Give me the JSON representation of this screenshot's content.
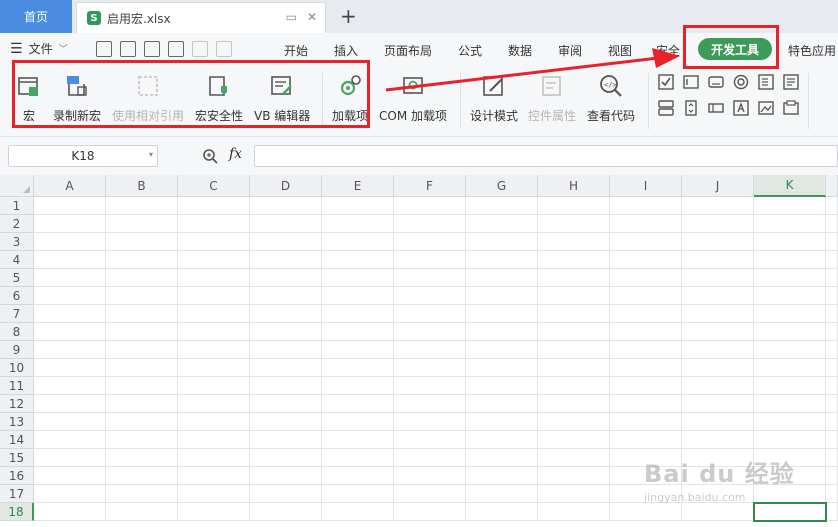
{
  "tabs": {
    "home": "首页",
    "file": "启用宏.xlsx",
    "file_icon": "S"
  },
  "menu": {
    "file_label": "文件",
    "items": [
      "开始",
      "插入",
      "页面布局",
      "公式",
      "数据",
      "审阅",
      "视图",
      "安全"
    ],
    "active": "开发工具",
    "after": "特色应用"
  },
  "ribbon": {
    "macro": "宏",
    "record_macro": "录制新宏",
    "relative_ref": "使用相对引用",
    "macro_security": "宏安全性",
    "vb_editor": "VB 编辑器",
    "addins": "加载项",
    "com_addins": "COM 加载项",
    "design_mode": "设计模式",
    "control_props": "控件属性",
    "view_code": "查看代码"
  },
  "formula_bar": {
    "name_box": "K18",
    "fx": "fx",
    "value": ""
  },
  "grid": {
    "columns": [
      "A",
      "B",
      "C",
      "D",
      "E",
      "F",
      "G",
      "H",
      "I",
      "J",
      "K"
    ],
    "rows": [
      "1",
      "2",
      "3",
      "4",
      "5",
      "6",
      "7",
      "8",
      "9",
      "10",
      "11",
      "12",
      "13",
      "14",
      "15",
      "16",
      "17",
      "18"
    ],
    "active_column": "K",
    "active_row": "18"
  },
  "watermark": {
    "big": "Bai du 经验",
    "small": "jingyan.baidu.com"
  },
  "colors": {
    "accent": "#3e9a59",
    "highlight": "#e8222b",
    "home_tab": "#4a8de0"
  }
}
